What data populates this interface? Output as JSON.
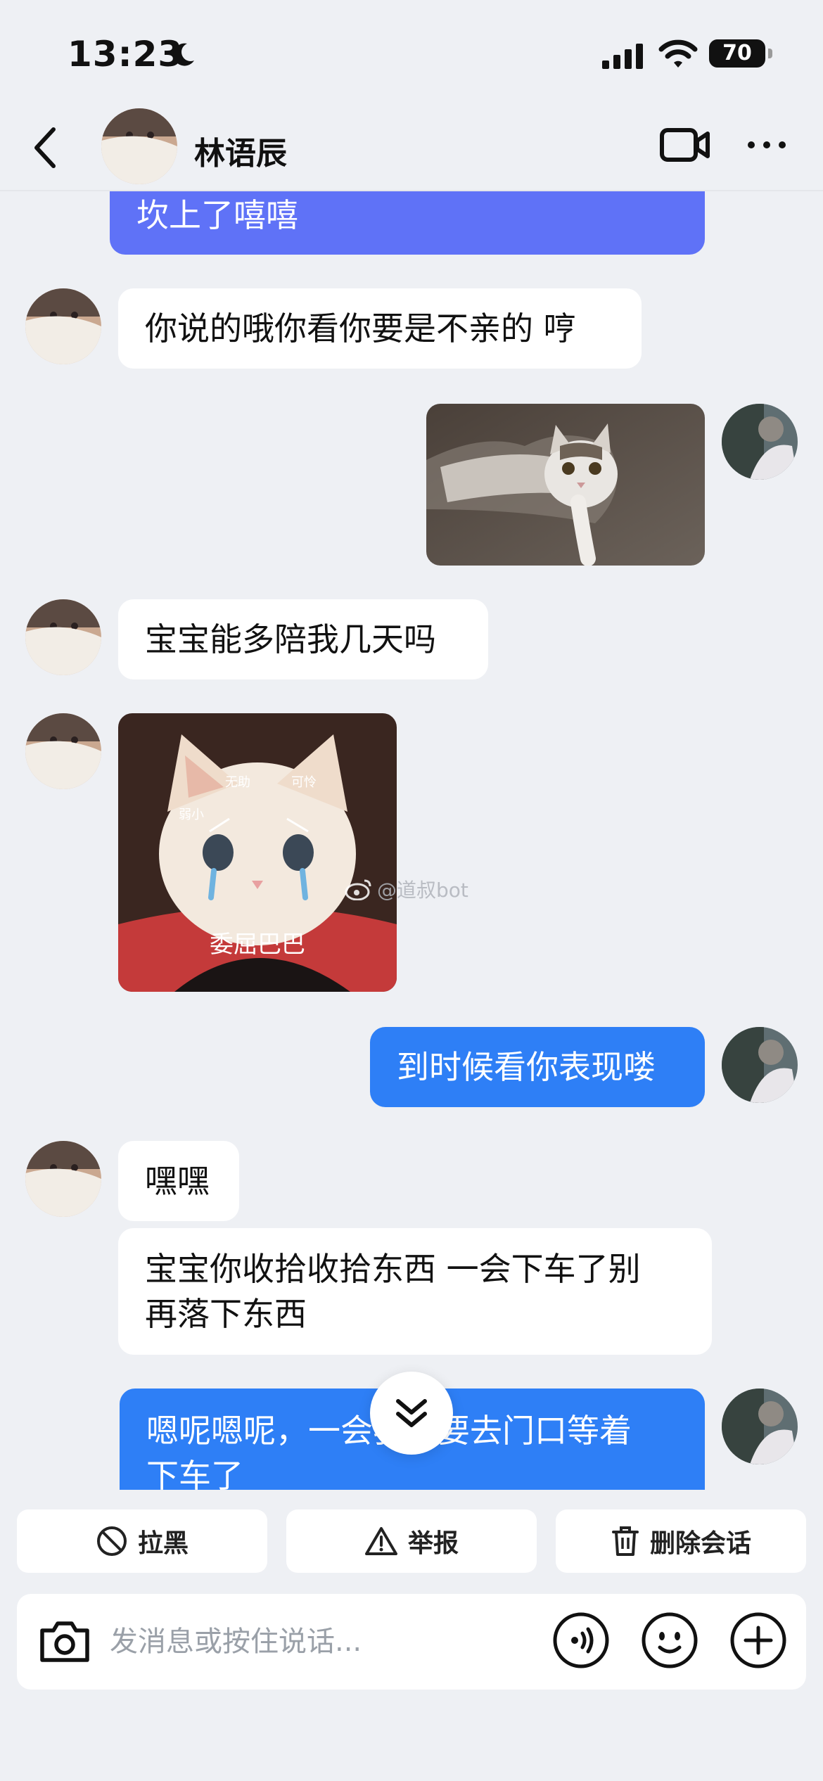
{
  "status_bar": {
    "time": "13:23",
    "battery": "70"
  },
  "header": {
    "contact_name": "林语辰"
  },
  "messages": [
    {
      "from": "me",
      "type": "text",
      "text": "坎上了嘻嘻"
    },
    {
      "from": "them",
      "type": "text",
      "text": "你说的哦你看你要是不亲的 哼"
    },
    {
      "from": "me",
      "type": "image",
      "description_icon": "cat-reaching-sticker"
    },
    {
      "from": "them",
      "type": "text",
      "text": "宝宝能多陪我几天吗"
    },
    {
      "from": "them",
      "type": "image",
      "sticker": {
        "labels": [
          "弱小",
          "无助",
          "可怜"
        ],
        "caption": "委屈巴巴",
        "watermark": "@道叔bot"
      }
    },
    {
      "from": "me",
      "type": "text",
      "text": "到时候看你表现喽"
    },
    {
      "from": "them",
      "type": "text",
      "text": "嘿嘿"
    },
    {
      "from": "them",
      "type": "text",
      "text_lines": [
        "宝宝你收拾收拾东西 一会下车了别",
        "再落下东西"
      ]
    },
    {
      "from": "me",
      "type": "text",
      "text_lines": [
        "嗯呢嗯呢，一会我就要去门口等着",
        "下车了"
      ]
    }
  ],
  "actions": {
    "block": "拉黑",
    "report": "举报",
    "delete": "删除会话"
  },
  "input": {
    "placeholder": "发消息或按住说话..."
  },
  "colors": {
    "outgoing": "#2e7ff6",
    "purple_bubble": "#5f72f7",
    "incoming": "#ffffff",
    "background": "#eef0f4"
  }
}
